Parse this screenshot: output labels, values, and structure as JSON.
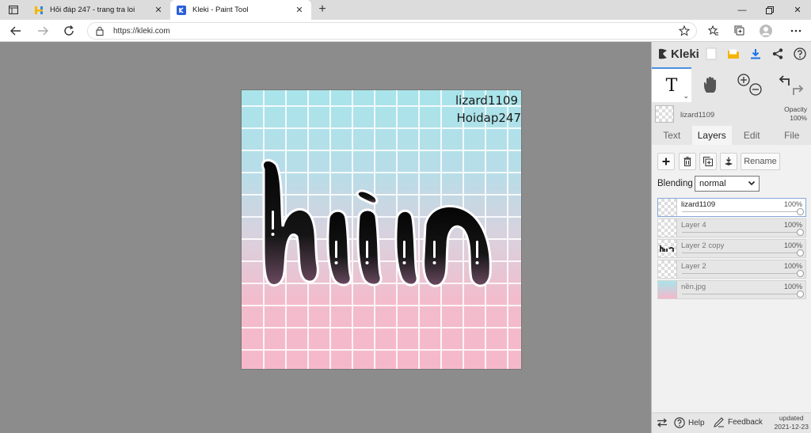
{
  "browser": {
    "tabs": [
      {
        "title": "Hỏi đáp 247 - trang tra loi",
        "favicon": "hoidap-logo-icon",
        "active": false
      },
      {
        "title": "Kleki - Paint Tool",
        "favicon": "kleki-logo-icon",
        "active": true
      }
    ],
    "new_tab": "+",
    "url": "https://kleki.com"
  },
  "artwork": {
    "watermark_lines": [
      "lizard1109",
      "Hoidap247"
    ],
    "artwork_text": "hiin",
    "colors": {
      "top": "#a8e4ea",
      "bottom": "#f5b8ca",
      "ink": "#111111"
    }
  },
  "kleki": {
    "logo_text": "Kleki",
    "tools": {
      "text_tool": "T"
    },
    "current_layer": {
      "name": "lizard1109",
      "opacity_label": "Opacity",
      "opacity_value": "100%"
    },
    "tabs": [
      {
        "label": "Text",
        "active": false
      },
      {
        "label": "Layers",
        "active": true
      },
      {
        "label": "Edit",
        "active": false
      },
      {
        "label": "File",
        "active": false
      }
    ],
    "rename_label": "Rename",
    "blending_label": "Blending",
    "blending_value": "normal",
    "layers": [
      {
        "name": "lizard1109",
        "opacity": "100%",
        "selected": true
      },
      {
        "name": "Layer 4",
        "opacity": "100%",
        "selected": false
      },
      {
        "name": "Layer 2 copy",
        "opacity": "100%",
        "selected": false
      },
      {
        "name": "Layer 2",
        "opacity": "100%",
        "selected": false
      },
      {
        "name": "nền.jpg",
        "opacity": "100%",
        "selected": false
      }
    ],
    "footer": {
      "help": "Help",
      "feedback": "Feedback",
      "updated_label": "updated",
      "updated_date": "2021-12-23"
    },
    "accent_color": "#4a90e2"
  }
}
